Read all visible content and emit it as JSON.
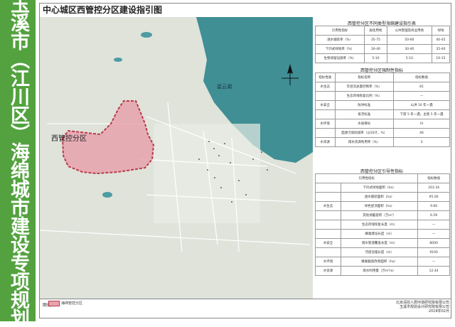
{
  "sidebar": {
    "title": "玉溪市（江川区）海绵城市建设专项规划"
  },
  "map": {
    "title": "中心城区西管控分区建设指引图",
    "lake_label": "星云湖",
    "zone_label": "西管控分区",
    "colors": {
      "zone_fill": "#e8a2ad",
      "zone_stroke": "#b93b4c",
      "lake": "#3f8f95",
      "sidebar": "#53a23f"
    }
  },
  "table1": {
    "title": "西管控分区不同类型海绵建设指引表",
    "header": [
      "引用性指标",
      "居住用地",
      "公共管理及商业用地",
      "绿地"
    ],
    "rows": [
      [
        "透水铺装率（%）",
        "35-75",
        "50-60",
        "40-45"
      ],
      [
        "下凹式绿地率（%）",
        "30-40",
        "30-40",
        "35-40"
      ],
      [
        "生物滞留设施率（%）",
        "5-10",
        "5-10",
        "10-15"
      ]
    ]
  },
  "table2": {
    "title": "西管控分区强制性指标",
    "header": [
      "指标性质",
      "指标名称",
      "指标数值"
    ],
    "rows": [
      [
        "水生态",
        "年径流总量控制率（%）",
        "81"
      ],
      [
        "",
        "生态岸线恢复比例（%）",
        "—"
      ],
      [
        "水安全",
        "防洪标准",
        "山洪 10 年一遇"
      ],
      [
        "",
        "排涝标准",
        "下游 5 年一遇，主管 5 年一遇"
      ],
      [
        "水环境",
        "水质目标",
        "III"
      ],
      [
        "",
        "面源污染削减率（以SS计，%）",
        "46"
      ],
      [
        "水资源",
        "雨水资源利用率（%）",
        "3"
      ]
    ]
  },
  "table3": {
    "title": "西管控分区引导性指标",
    "header": [
      "引用性指标",
      "指标数值"
    ],
    "rows": [
      [
        "",
        "下凹式绿地面积（ha）",
        "203.34"
      ],
      [
        "",
        "透水铺装面积（ha）",
        "95.00"
      ],
      [
        "水生态",
        "绿色屋顶面积（ha）",
        "9.66"
      ],
      [
        "",
        "其他调蓄容积（万m³）",
        "6.59"
      ],
      [
        "",
        "生态岸线恢复长度（m）",
        "—"
      ],
      [
        "",
        "蜂巢建设长度（m）",
        "—"
      ],
      [
        "水安全",
        "雨水管道覆盖长度（m）",
        "8000"
      ],
      [
        "",
        "河道治理长度（m）",
        "9100"
      ],
      [
        "水环境",
        "蜂巢截留改善面积（ha）",
        "—"
      ],
      [
        "水资源",
        "雨水利用量（万m³/a）",
        "12.44"
      ]
    ]
  },
  "legend": {
    "label": "图例",
    "item": "海绵管控分区"
  },
  "credits": [
    "北京清控人居环境研究院有限公司",
    "玉溪市规划设计研究院有限公司",
    "2018年02月"
  ]
}
